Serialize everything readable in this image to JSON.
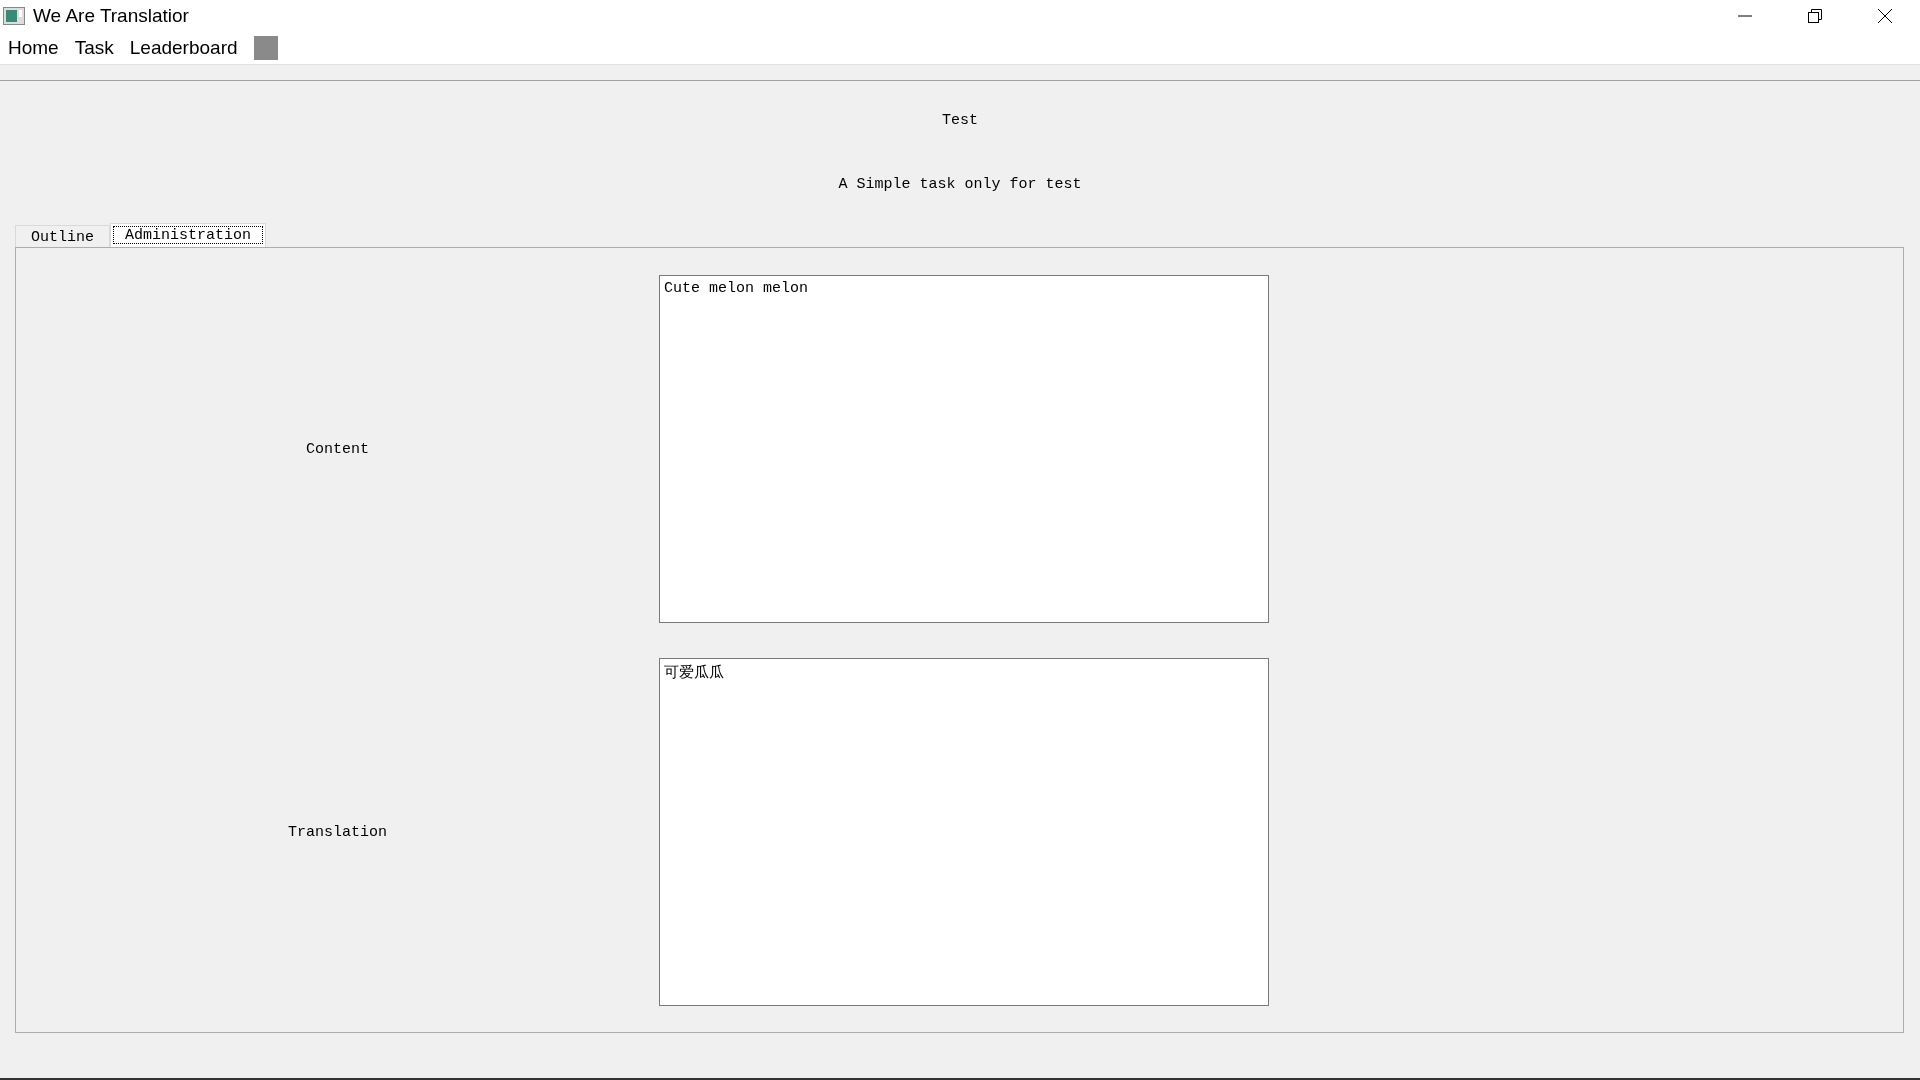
{
  "window": {
    "title": "We Are Translatior"
  },
  "menu": [
    {
      "label": "Home"
    },
    {
      "label": "Task"
    },
    {
      "label": "Leaderboard"
    }
  ],
  "task": {
    "title": "Test",
    "description": "A Simple task only for test"
  },
  "tabs": [
    {
      "label": "Outline",
      "selected": false
    },
    {
      "label": "Administration",
      "selected": true
    }
  ],
  "fields": [
    {
      "label": "Content",
      "value": "Cute melon melon"
    },
    {
      "label": "Translation",
      "value": "可爱瓜瓜"
    }
  ]
}
